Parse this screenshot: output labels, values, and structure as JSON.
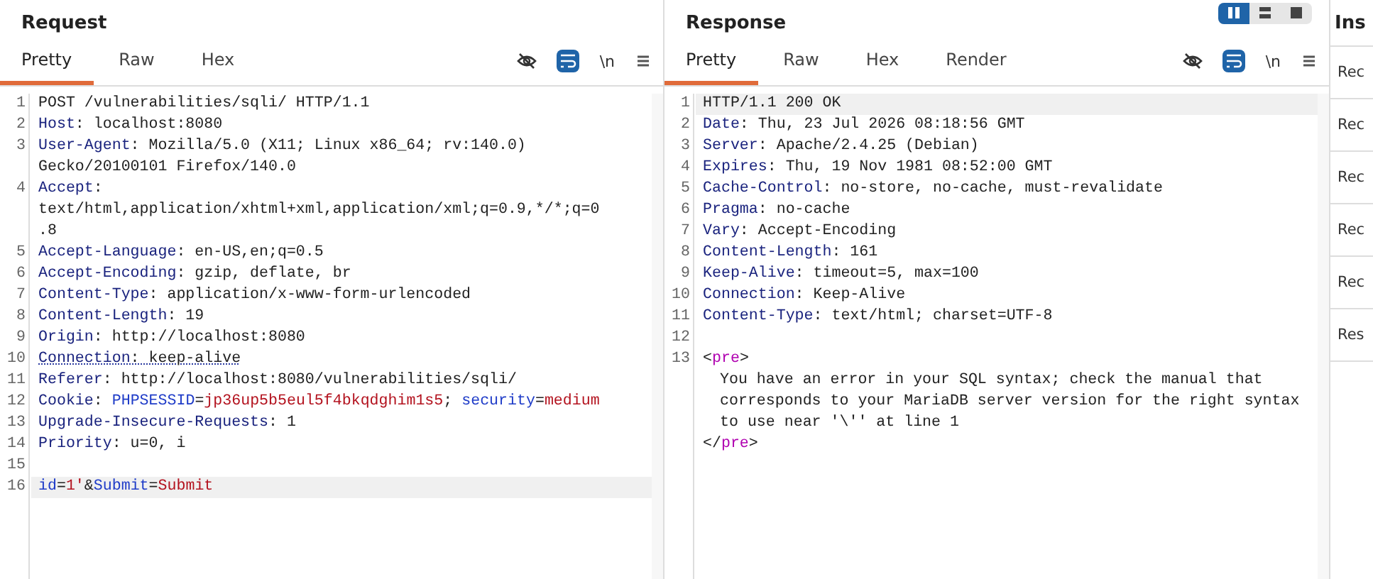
{
  "panels": [
    {
      "title": "Request",
      "tabs": [
        {
          "label": "Pretty",
          "selected": true
        },
        {
          "label": "Raw",
          "selected": false
        },
        {
          "label": "Hex",
          "selected": false
        }
      ],
      "toolbar": [
        {
          "kind": "hide",
          "on": false
        },
        {
          "kind": "wrap",
          "on": true
        },
        {
          "kind": "newline",
          "label": "\\n",
          "on": false
        },
        {
          "kind": "menu"
        }
      ],
      "lines": [
        {
          "number": "1",
          "current": false,
          "flagged": false,
          "rows": [
            {
              "indented": false,
              "tokens": [
                {
                  "kind": "plain",
                  "text": "POST /vulnerabilities/sqli/ HTTP/1.1"
                }
              ]
            }
          ]
        },
        {
          "number": "2",
          "current": false,
          "flagged": false,
          "rows": [
            {
              "indented": false,
              "tokens": [
                {
                  "kind": "header",
                  "text": "Host"
                },
                {
                  "kind": "plain",
                  "text": ": localhost:8080"
                }
              ]
            }
          ]
        },
        {
          "number": "3",
          "current": false,
          "flagged": false,
          "rows": [
            {
              "indented": false,
              "tokens": [
                {
                  "kind": "header",
                  "text": "User-Agent"
                },
                {
                  "kind": "plain",
                  "text": ": Mozilla/5.0 (X11; Linux x86_64; rv:140.0)"
                }
              ]
            },
            {
              "indented": false,
              "tokens": [
                {
                  "kind": "plain",
                  "text": "Gecko/20100101 Firefox/140.0"
                }
              ]
            }
          ]
        },
        {
          "number": "4",
          "current": false,
          "flagged": false,
          "rows": [
            {
              "indented": false,
              "tokens": [
                {
                  "kind": "header",
                  "text": "Accept"
                },
                {
                  "kind": "plain",
                  "text": ":"
                }
              ]
            },
            {
              "indented": false,
              "tokens": [
                {
                  "kind": "plain",
                  "text": "text/html,application/xhtml+xml,application/xml;q=0.9,*/*;q=0"
                }
              ]
            },
            {
              "indented": false,
              "tokens": [
                {
                  "kind": "plain",
                  "text": ".8"
                }
              ]
            }
          ]
        },
        {
          "number": "5",
          "current": false,
          "flagged": false,
          "rows": [
            {
              "indented": false,
              "tokens": [
                {
                  "kind": "header",
                  "text": "Accept-Language"
                },
                {
                  "kind": "plain",
                  "text": ": en-US,en;q=0.5"
                }
              ]
            }
          ]
        },
        {
          "number": "6",
          "current": false,
          "flagged": false,
          "rows": [
            {
              "indented": false,
              "tokens": [
                {
                  "kind": "header",
                  "text": "Accept-Encoding"
                },
                {
                  "kind": "plain",
                  "text": ": gzip, deflate, br"
                }
              ]
            }
          ]
        },
        {
          "number": "7",
          "current": false,
          "flagged": false,
          "rows": [
            {
              "indented": false,
              "tokens": [
                {
                  "kind": "header",
                  "text": "Content-Type"
                },
                {
                  "kind": "plain",
                  "text": ": application/x-www-form-urlencoded"
                }
              ]
            }
          ]
        },
        {
          "number": "8",
          "current": false,
          "flagged": false,
          "rows": [
            {
              "indented": false,
              "tokens": [
                {
                  "kind": "header",
                  "text": "Content-Length"
                },
                {
                  "kind": "plain",
                  "text": ": 19"
                }
              ]
            }
          ]
        },
        {
          "number": "9",
          "current": false,
          "flagged": false,
          "rows": [
            {
              "indented": false,
              "tokens": [
                {
                  "kind": "header",
                  "text": "Origin"
                },
                {
                  "kind": "plain",
                  "text": ": http://localhost:8080"
                }
              ]
            }
          ]
        },
        {
          "number": "10",
          "current": false,
          "flagged": true,
          "rows": [
            {
              "indented": false,
              "tokens": [
                {
                  "kind": "header",
                  "text": "Connection"
                },
                {
                  "kind": "plain",
                  "text": ": keep-alive"
                }
              ]
            }
          ]
        },
        {
          "number": "11",
          "current": false,
          "flagged": false,
          "rows": [
            {
              "indented": false,
              "tokens": [
                {
                  "kind": "header",
                  "text": "Referer"
                },
                {
                  "kind": "plain",
                  "text": ": http://localhost:8080/vulnerabilities/sqli/"
                }
              ]
            }
          ]
        },
        {
          "number": "12",
          "current": false,
          "flagged": false,
          "rows": [
            {
              "indented": false,
              "tokens": [
                {
                  "kind": "header",
                  "text": "Cookie"
                },
                {
                  "kind": "plain",
                  "text": ": "
                },
                {
                  "kind": "param",
                  "text": "PHPSESSID"
                },
                {
                  "kind": "plain",
                  "text": "="
                },
                {
                  "kind": "value",
                  "text": "jp36up5b5eul5f4bkqdghim1s5"
                },
                {
                  "kind": "plain",
                  "text": "; "
                },
                {
                  "kind": "param",
                  "text": "security"
                },
                {
                  "kind": "plain",
                  "text": "="
                },
                {
                  "kind": "value",
                  "text": "medium"
                }
              ]
            }
          ]
        },
        {
          "number": "13",
          "current": false,
          "flagged": false,
          "rows": [
            {
              "indented": false,
              "tokens": [
                {
                  "kind": "header",
                  "text": "Upgrade-Insecure-Requests"
                },
                {
                  "kind": "plain",
                  "text": ": 1"
                }
              ]
            }
          ]
        },
        {
          "number": "14",
          "current": false,
          "flagged": false,
          "rows": [
            {
              "indented": false,
              "tokens": [
                {
                  "kind": "header",
                  "text": "Priority"
                },
                {
                  "kind": "plain",
                  "text": ": u=0, i"
                }
              ]
            }
          ]
        },
        {
          "number": "15",
          "current": false
        },
        {
          "number": "16",
          "current": true,
          "flagged": false,
          "rows": [
            {
              "indented": false,
              "tokens": [
                {
                  "kind": "param",
                  "text": "id"
                },
                {
                  "kind": "plain",
                  "text": "="
                },
                {
                  "kind": "value",
                  "text": "1'"
                },
                {
                  "kind": "plain",
                  "text": "&"
                },
                {
                  "kind": "param",
                  "text": "Submit"
                },
                {
                  "kind": "plain",
                  "text": "="
                },
                {
                  "kind": "value",
                  "text": "Submit"
                }
              ]
            }
          ]
        }
      ]
    },
    {
      "title": "Response",
      "view_toggle": [
        {
          "kind": "columns",
          "selected": true
        },
        {
          "kind": "rows",
          "selected": false
        },
        {
          "kind": "single",
          "selected": false
        }
      ],
      "tabs": [
        {
          "label": "Pretty",
          "selected": true
        },
        {
          "label": "Raw",
          "selected": false
        },
        {
          "label": "Hex",
          "selected": false
        },
        {
          "label": "Render",
          "selected": false
        }
      ],
      "toolbar": [
        {
          "kind": "hide",
          "on": false
        },
        {
          "kind": "wrap",
          "on": true
        },
        {
          "kind": "newline",
          "label": "\\n",
          "on": false
        },
        {
          "kind": "menu"
        }
      ],
      "lines": [
        {
          "number": "1",
          "current": true,
          "flagged": false,
          "rows": [
            {
              "indented": false,
              "tokens": [
                {
                  "kind": "plain",
                  "text": "HTTP/1.1 200 OK"
                }
              ]
            }
          ]
        },
        {
          "number": "2",
          "current": false,
          "flagged": false,
          "rows": [
            {
              "indented": false,
              "tokens": [
                {
                  "kind": "header",
                  "text": "Date"
                },
                {
                  "kind": "plain",
                  "text": ": Thu, 23 Jul 2026 08:18:56 GMT"
                }
              ]
            }
          ]
        },
        {
          "number": "3",
          "current": false,
          "flagged": false,
          "rows": [
            {
              "indented": false,
              "tokens": [
                {
                  "kind": "header",
                  "text": "Server"
                },
                {
                  "kind": "plain",
                  "text": ": Apache/2.4.25 (Debian)"
                }
              ]
            }
          ]
        },
        {
          "number": "4",
          "current": false,
          "flagged": false,
          "rows": [
            {
              "indented": false,
              "tokens": [
                {
                  "kind": "header",
                  "text": "Expires"
                },
                {
                  "kind": "plain",
                  "text": ": Thu, 19 Nov 1981 08:52:00 GMT"
                }
              ]
            }
          ]
        },
        {
          "number": "5",
          "current": false,
          "flagged": false,
          "rows": [
            {
              "indented": false,
              "tokens": [
                {
                  "kind": "header",
                  "text": "Cache-Control"
                },
                {
                  "kind": "plain",
                  "text": ": no-store, no-cache, must-revalidate"
                }
              ]
            }
          ]
        },
        {
          "number": "6",
          "current": false,
          "flagged": false,
          "rows": [
            {
              "indented": false,
              "tokens": [
                {
                  "kind": "header",
                  "text": "Pragma"
                },
                {
                  "kind": "plain",
                  "text": ": no-cache"
                }
              ]
            }
          ]
        },
        {
          "number": "7",
          "current": false,
          "flagged": false,
          "rows": [
            {
              "indented": false,
              "tokens": [
                {
                  "kind": "header",
                  "text": "Vary"
                },
                {
                  "kind": "plain",
                  "text": ": Accept-Encoding"
                }
              ]
            }
          ]
        },
        {
          "number": "8",
          "current": false,
          "flagged": false,
          "rows": [
            {
              "indented": false,
              "tokens": [
                {
                  "kind": "header",
                  "text": "Content-Length"
                },
                {
                  "kind": "plain",
                  "text": ": 161"
                }
              ]
            }
          ]
        },
        {
          "number": "9",
          "current": false,
          "flagged": false,
          "rows": [
            {
              "indented": false,
              "tokens": [
                {
                  "kind": "header",
                  "text": "Keep-Alive"
                },
                {
                  "kind": "plain",
                  "text": ": timeout=5, max=100"
                }
              ]
            }
          ]
        },
        {
          "number": "10",
          "current": false,
          "flagged": false,
          "rows": [
            {
              "indented": false,
              "tokens": [
                {
                  "kind": "header",
                  "text": "Connection"
                },
                {
                  "kind": "plain",
                  "text": ": Keep-Alive"
                }
              ]
            }
          ]
        },
        {
          "number": "11",
          "current": false,
          "flagged": false,
          "rows": [
            {
              "indented": false,
              "tokens": [
                {
                  "kind": "header",
                  "text": "Content-Type"
                },
                {
                  "kind": "plain",
                  "text": ": text/html; charset=UTF-8"
                }
              ]
            }
          ]
        },
        {
          "number": "12",
          "current": false
        },
        {
          "number": "13",
          "current": false,
          "flagged": false,
          "rows": [
            {
              "indented": false,
              "tokens": [
                {
                  "kind": "plain",
                  "text": "<"
                },
                {
                  "kind": "tag",
                  "text": "pre"
                },
                {
                  "kind": "plain",
                  "text": ">"
                }
              ]
            },
            {
              "indented": true,
              "tokens": [
                {
                  "kind": "plain",
                  "text": "You have an error in your SQL syntax; check the manual that"
                }
              ]
            },
            {
              "indented": true,
              "tokens": [
                {
                  "kind": "plain",
                  "text": "corresponds to your MariaDB server version for the right syntax"
                }
              ]
            },
            {
              "indented": true,
              "tokens": [
                {
                  "kind": "plain",
                  "text": "to use near '\\'' at line 1"
                }
              ]
            },
            {
              "indented": false,
              "tokens": [
                {
                  "kind": "plain",
                  "text": "</"
                },
                {
                  "kind": "tag",
                  "text": "pre"
                },
                {
                  "kind": "plain",
                  "text": ">"
                }
              ]
            }
          ]
        }
      ]
    }
  ],
  "inspector": {
    "title": "Ins",
    "items": [
      "Rec",
      "Rec",
      "Rec",
      "Rec",
      "Rec",
      "Res"
    ]
  }
}
